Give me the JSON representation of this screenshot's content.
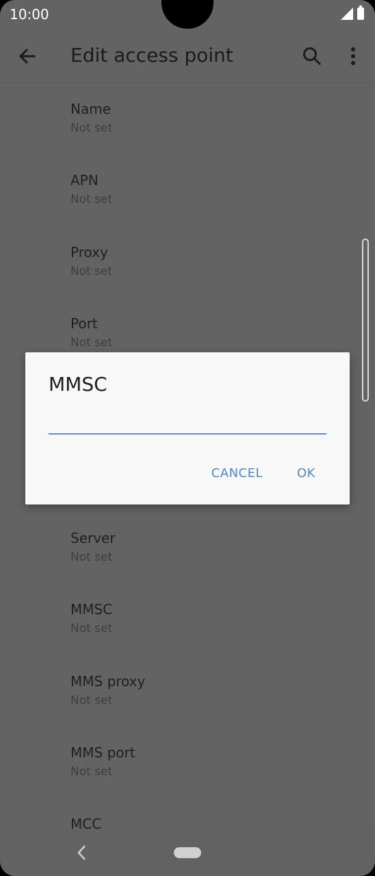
{
  "status_bar": {
    "time": "10:00"
  },
  "app_bar": {
    "title": "Edit access point",
    "icons": {
      "back": "arrow-left",
      "search": "magnifier",
      "more": "vertical-dots"
    }
  },
  "settings": {
    "items": [
      {
        "title": "Name",
        "value": "Not set"
      },
      {
        "title": "APN",
        "value": "Not set"
      },
      {
        "title": "Proxy",
        "value": "Not set"
      },
      {
        "title": "Port",
        "value": "Not set"
      },
      {
        "title": "Server",
        "value": "Not set"
      },
      {
        "title": "MMSC",
        "value": "Not set"
      },
      {
        "title": "MMS proxy",
        "value": "Not set"
      },
      {
        "title": "MMS port",
        "value": "Not set"
      },
      {
        "title": "MCC",
        "value": ""
      }
    ]
  },
  "dialog": {
    "title": "MMSC",
    "input_value": "",
    "cancel_label": "CANCEL",
    "ok_label": "OK"
  },
  "colors": {
    "accent": "#4a88d8",
    "scrim_background": "#636363",
    "dialog_background": "#f8f8f8"
  }
}
